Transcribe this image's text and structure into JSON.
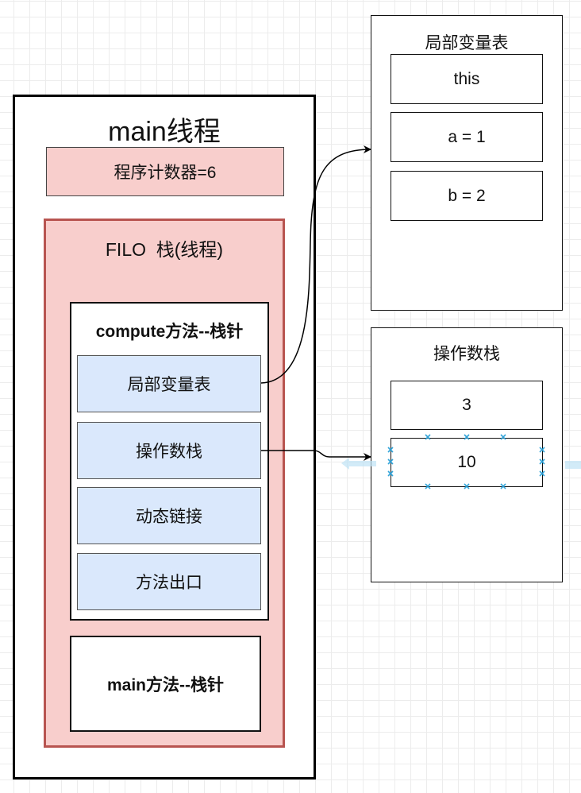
{
  "main_thread": {
    "title": "main线程",
    "program_counter": "程序计数器=6"
  },
  "stack": {
    "title": "FILO  栈(线程)",
    "compute_frame": {
      "title": "compute方法--栈针",
      "items": [
        "局部变量表",
        "操作数栈",
        "动态链接",
        "方法出口"
      ]
    },
    "main_frame": {
      "title": "main方法--栈针"
    }
  },
  "local_variable_table": {
    "title": "局部变量表",
    "items": [
      "this",
      "a = 1",
      "b = 2"
    ]
  },
  "operand_stack": {
    "title": "操作数栈",
    "items": [
      "3",
      "10"
    ],
    "selected_item": "10"
  },
  "colors": {
    "pink_fill": "#f8cecc",
    "stack_border": "#b85450",
    "blue_fill": "#dae8fc",
    "selection": "#29a0d8"
  }
}
